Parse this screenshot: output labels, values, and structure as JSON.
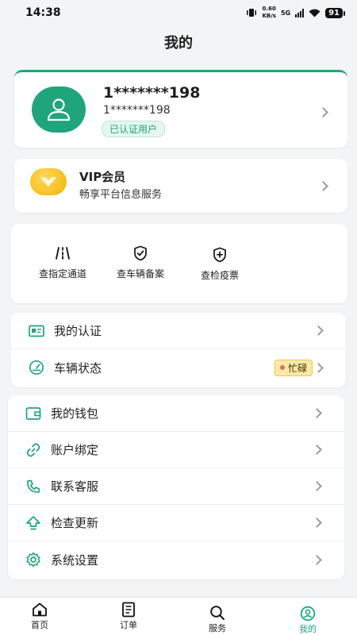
{
  "status_bar": {
    "time": "14:38",
    "net_speed_value": "0.60",
    "net_speed_unit": "KB/s",
    "network": "5G",
    "battery": "91"
  },
  "header": {
    "title": "我的"
  },
  "profile": {
    "name": "1*******198",
    "sub": "1*******198",
    "badge": "已认证用户"
  },
  "vip": {
    "title": "VIP会员",
    "subtitle": "畅享平台信息服务"
  },
  "quick_actions": [
    {
      "label": "查指定通道",
      "icon": "road-icon"
    },
    {
      "label": "查车辆备案",
      "icon": "shield-check-icon"
    },
    {
      "label": "查检疫票",
      "icon": "shield-plus-icon"
    }
  ],
  "menu_group_1": [
    {
      "label": "我的认证",
      "icon": "id-card-icon"
    },
    {
      "label": "车辆状态",
      "icon": "gauge-icon",
      "badge": "忙碌"
    }
  ],
  "menu_group_2": [
    {
      "label": "我的钱包",
      "icon": "wallet-icon"
    },
    {
      "label": "账户绑定",
      "icon": "link-icon"
    },
    {
      "label": "联系客服",
      "icon": "phone-icon"
    },
    {
      "label": "检查更新",
      "icon": "upload-arrow-icon"
    },
    {
      "label": "系统设置",
      "icon": "gear-icon"
    }
  ],
  "tabs": [
    {
      "label": "首页",
      "icon": "home-icon"
    },
    {
      "label": "订单",
      "icon": "order-icon"
    },
    {
      "label": "服务",
      "icon": "search-icon"
    },
    {
      "label": "我的",
      "icon": "user-icon",
      "active": true
    }
  ],
  "colors": {
    "accent": "#1ea67a",
    "vip_gold": "#f3b400",
    "busy_badge": "#fbe9a6"
  }
}
